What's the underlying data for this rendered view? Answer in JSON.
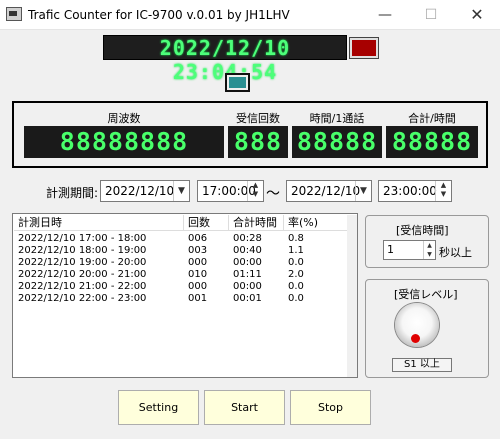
{
  "window": {
    "title": "Trafic Counter for IC-9700 v.0.01 by JH1LHV",
    "minimize_glyph": "—",
    "maximize_glyph": "☐",
    "close_glyph": "✕",
    "icon": "app-icon"
  },
  "clock": {
    "datetime": "2022/12/10 23:04:54",
    "indicator_color": "#a70000",
    "status_color": "#2a8f92"
  },
  "meters": {
    "labels": {
      "frequency": "周波数",
      "receive_count": "受信回数",
      "time_per_call": "時間/1通話",
      "total_time": "合計/時間"
    },
    "values": {
      "frequency": "88888888",
      "receive_count": "888",
      "time_per_call": "88888",
      "total_time": "88888"
    },
    "digit_color": "#48ff6a"
  },
  "period": {
    "label": "計測期間:",
    "start_date": "2022/12/10",
    "start_time": "17:00:00",
    "separator": "～",
    "end_date": "2022/12/10",
    "end_time": "23:00:00",
    "dropdown_glyph": "▼",
    "spin_up": "▲",
    "spin_down": "▼"
  },
  "table": {
    "columns": [
      "計測日時",
      "回数",
      "合計時間",
      "率(%)"
    ],
    "rows": [
      [
        "2022/12/10 17:00 - 18:00",
        "006",
        "00:28",
        "0.8"
      ],
      [
        "2022/12/10 18:00 - 19:00",
        "003",
        "00:40",
        "1.1"
      ],
      [
        "2022/12/10 19:00 - 20:00",
        "000",
        "00:00",
        "0.0"
      ],
      [
        "2022/12/10 20:00 - 21:00",
        "010",
        "01:11",
        "2.0"
      ],
      [
        "2022/12/10 21:00 - 22:00",
        "000",
        "00:00",
        "0.0"
      ],
      [
        "2022/12/10 22:00 - 23:00",
        "001",
        "00:01",
        "0.0"
      ]
    ]
  },
  "receive_time": {
    "title": "[受信時間]",
    "value": "1",
    "unit": "秒以上",
    "spin_up": "▲",
    "spin_down": "▼"
  },
  "receive_level": {
    "title": "[受信レベル]",
    "value": "S1 以上",
    "knob_indicator_color": "#e00000"
  },
  "buttons": {
    "setting": "Setting",
    "start": "Start",
    "stop": "Stop",
    "color": "#ffffdc"
  }
}
